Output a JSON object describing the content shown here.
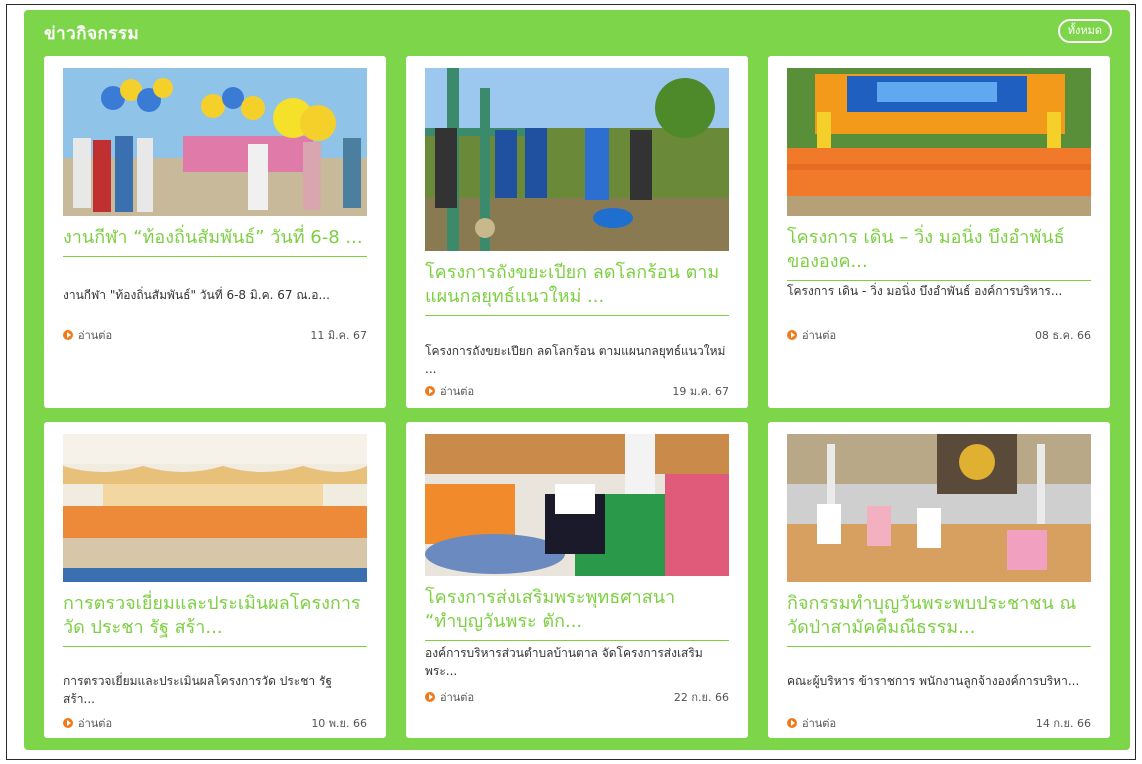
{
  "section": {
    "title": "ข่าวกิจกรรม",
    "all_label": "ทั้งหมด"
  },
  "colors": {
    "panel_green": "#7dd54a",
    "title_green": "#7dcf42",
    "readmore_orange": "#f07a1a"
  },
  "read_more_label": "อ่านต่อ",
  "cards": [
    {
      "title": "งานกีฬา “ท้องถิ่นสัมพันธ์” วันที่ 6-8 ...",
      "excerpt": "งานกีฬา \"ท้องถิ่นสัมพันธ์\" วันที่ 6-8 มิ.ค. 67 ณ.อ...",
      "date": "11 มิ.ค. 67"
    },
    {
      "title": "โครงการถังขยะเปียก ลดโลกร้อน ตามแผนกลยุทธ์แนวใหม่ ...",
      "excerpt": "โครงการถังขยะเปียก ลดโลกร้อน ตามแผนกลยุทธ์แนวใหม่ ...",
      "date": "19 ม.ค. 67"
    },
    {
      "title": "โครงการ เดิน – วิ่ง มอนิ่ง บึงอำพันธ์ ขององค...",
      "excerpt": "โครงการ เดิน - วิ่ง มอนิ่ง บึงอำพันธ์ องค์การบริหาร...",
      "date": "08 ธ.ค. 66"
    },
    {
      "title": "การตรวจเยี่ยมและประเมินผลโครงการวัด ประชา รัฐ สร้า...",
      "excerpt": "การตรวจเยี่ยมและประเมินผลโครงการวัด ประชา รัฐ สร้า...",
      "date": "10 พ.ย. 66"
    },
    {
      "title": "โครงการส่งเสริมพระพุทธศาสนา “ทำบุญวันพระ ตัก...",
      "excerpt": "องค์การบริหารส่วนตำบลบ้านตาล จัดโครงการส่งเสริมพระ...",
      "date": "22 ก.ย. 66"
    },
    {
      "title": "กิจกรรมทำบุญวันพระพบประชาชน ณ วัดป่าสามัคคีมณีธรรม...",
      "excerpt": "คณะผู้บริหาร ข้าราชการ พนักงานลูกจ้างองค์การบริหา...",
      "date": "14 ก.ย. 66"
    }
  ]
}
